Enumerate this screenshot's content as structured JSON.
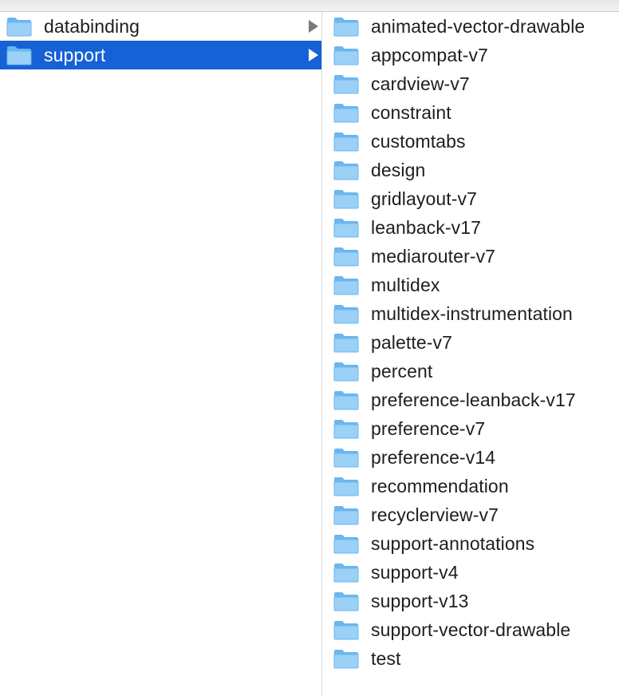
{
  "colors": {
    "selection": "#1561d5",
    "folder_light": "#9bd0f7",
    "folder_dark": "#6bb6ef",
    "text": "#1e1e1e"
  },
  "column1": {
    "items": [
      {
        "label": "databinding",
        "icon": "folder-icon",
        "has_children": true,
        "selected": false
      },
      {
        "label": "support",
        "icon": "folder-icon",
        "has_children": true,
        "selected": true
      }
    ]
  },
  "column2": {
    "items": [
      {
        "label": "animated-vector-drawable",
        "icon": "folder-icon"
      },
      {
        "label": "appcompat-v7",
        "icon": "folder-icon"
      },
      {
        "label": "cardview-v7",
        "icon": "folder-icon"
      },
      {
        "label": "constraint",
        "icon": "folder-icon"
      },
      {
        "label": "customtabs",
        "icon": "folder-icon"
      },
      {
        "label": "design",
        "icon": "folder-icon"
      },
      {
        "label": "gridlayout-v7",
        "icon": "folder-icon"
      },
      {
        "label": "leanback-v17",
        "icon": "folder-icon"
      },
      {
        "label": "mediarouter-v7",
        "icon": "folder-icon"
      },
      {
        "label": "multidex",
        "icon": "folder-icon"
      },
      {
        "label": "multidex-instrumentation",
        "icon": "folder-icon"
      },
      {
        "label": "palette-v7",
        "icon": "folder-icon"
      },
      {
        "label": "percent",
        "icon": "folder-icon"
      },
      {
        "label": "preference-leanback-v17",
        "icon": "folder-icon"
      },
      {
        "label": "preference-v7",
        "icon": "folder-icon"
      },
      {
        "label": "preference-v14",
        "icon": "folder-icon"
      },
      {
        "label": "recommendation",
        "icon": "folder-icon"
      },
      {
        "label": "recyclerview-v7",
        "icon": "folder-icon"
      },
      {
        "label": "support-annotations",
        "icon": "folder-icon"
      },
      {
        "label": "support-v4",
        "icon": "folder-icon"
      },
      {
        "label": "support-v13",
        "icon": "folder-icon"
      },
      {
        "label": "support-vector-drawable",
        "icon": "folder-icon"
      },
      {
        "label": "test",
        "icon": "folder-icon"
      }
    ]
  }
}
